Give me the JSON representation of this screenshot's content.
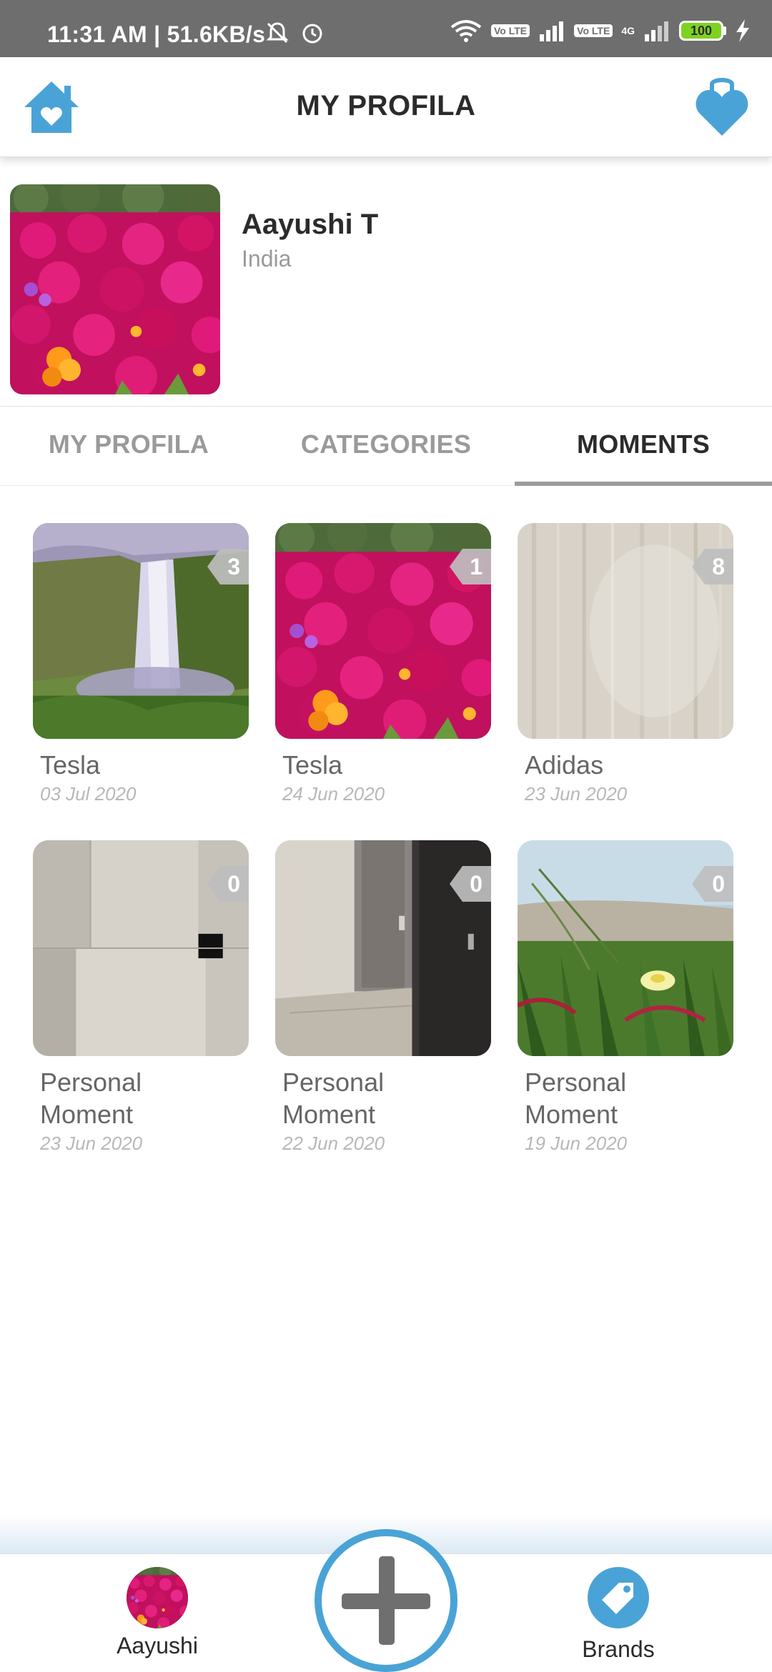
{
  "status_bar": {
    "time": "11:31 AM | 51.6KB/s",
    "network_1": "Vo LTE",
    "network_2": "Vo LTE",
    "network_3": "4G",
    "battery": "100"
  },
  "app_bar": {
    "title": "MY PROFILA",
    "left_icon": "home-heart-icon",
    "right_icon": "heart-bag-icon"
  },
  "profile": {
    "name": "Aayushi T",
    "country": "India"
  },
  "tabs": [
    {
      "label": "MY PROFILA",
      "active": false
    },
    {
      "label": "CATEGORIES",
      "active": false
    },
    {
      "label": "MOMENTS",
      "active": true
    }
  ],
  "moments": [
    {
      "title": "Tesla",
      "date": "03 Jul 2020",
      "count": "3"
    },
    {
      "title": "Tesla",
      "date": "24 Jun 2020",
      "count": "1"
    },
    {
      "title": "Adidas",
      "date": "23 Jun 2020",
      "count": "8"
    },
    {
      "title": "Personal Moment",
      "date": "23 Jun 2020",
      "count": "0"
    },
    {
      "title": "Personal Moment",
      "date": "22 Jun 2020",
      "count": "0"
    },
    {
      "title": "Personal Moment",
      "date": "19 Jun 2020",
      "count": "0"
    }
  ],
  "bottom_nav": {
    "profile_label": "Aayushi",
    "brands_label": "Brands"
  },
  "colors": {
    "accent": "#4aa3d6",
    "status_bar": "#6e6e6e",
    "tab_active": "#2b2b2b",
    "tab_inactive": "#9a9a9a"
  }
}
